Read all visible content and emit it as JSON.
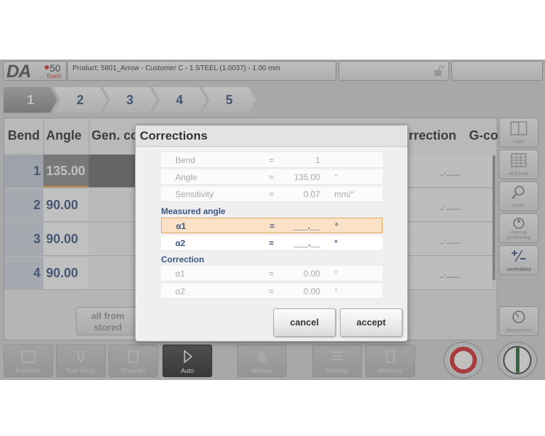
{
  "header": {
    "logo_text": "DA",
    "logo_model": "50",
    "logo_sub": "Touch",
    "product": "Product: 5801_Arrow - Customer C - 1 STEEL (1.0037) - 1.00 mm"
  },
  "steps": [
    "1",
    "2",
    "3",
    "4",
    "5"
  ],
  "table": {
    "headers": {
      "bend": "Bend",
      "angle": "Angle",
      "gen": "Gen. co",
      "correction": "rrection",
      "gc": "G-co"
    },
    "rows": [
      {
        "bend": "1",
        "angle": "135.00",
        "correction": "_.___"
      },
      {
        "bend": "2",
        "angle": "90.00",
        "correction": "_.___"
      },
      {
        "bend": "3",
        "angle": "90.00",
        "correction": "_.___"
      },
      {
        "bend": "4",
        "angle": "90.00",
        "correction": "_.___"
      }
    ],
    "all_from_stored": "all from stored"
  },
  "sidebar": [
    {
      "name": "main",
      "label": "main"
    },
    {
      "name": "all-bends",
      "label": "all bends"
    },
    {
      "name": "zoom",
      "label": "zoom"
    },
    {
      "name": "manual-positioning",
      "label": "manual positioning"
    },
    {
      "name": "corrections",
      "label": "corrections"
    },
    {
      "name": "diagnostics",
      "label": "diagnostics"
    }
  ],
  "bottom_nav": [
    {
      "name": "products",
      "label": "Products"
    },
    {
      "name": "tool-setup",
      "label": "Tool setup"
    },
    {
      "name": "program",
      "label": "Program"
    },
    {
      "name": "auto",
      "label": "Auto"
    },
    {
      "name": "manual",
      "label": "Manual"
    },
    {
      "name": "settings",
      "label": "Settings"
    },
    {
      "name": "machine",
      "label": "Machine"
    }
  ],
  "dialog": {
    "title": "Corrections",
    "rows": [
      {
        "label": "Bend",
        "eq": "=",
        "value": "1",
        "unit": ""
      },
      {
        "label": "Angle",
        "eq": "=",
        "value": "135.00",
        "unit": "°"
      },
      {
        "label": "Sensitivity",
        "eq": "=",
        "value": "0.07",
        "unit": "mm/°"
      }
    ],
    "measured_title": "Measured angle",
    "measured": [
      {
        "label": "α1",
        "eq": "=",
        "value": "___.__",
        "unit": "°"
      },
      {
        "label": "α2",
        "eq": "=",
        "value": "___.__",
        "unit": "°"
      }
    ],
    "correction_title": "Correction",
    "correction": [
      {
        "label": "α1",
        "eq": "=",
        "value": "0.00",
        "unit": "°"
      },
      {
        "label": "α2",
        "eq": "=",
        "value": "0.00",
        "unit": "°"
      }
    ],
    "cancel": "cancel",
    "accept": "accept"
  },
  "colors": {
    "accent_blue": "#3a5685",
    "focus_orange": "#e6a15a",
    "stop_red": "#d92a2a",
    "start_green": "#1f6b34"
  }
}
